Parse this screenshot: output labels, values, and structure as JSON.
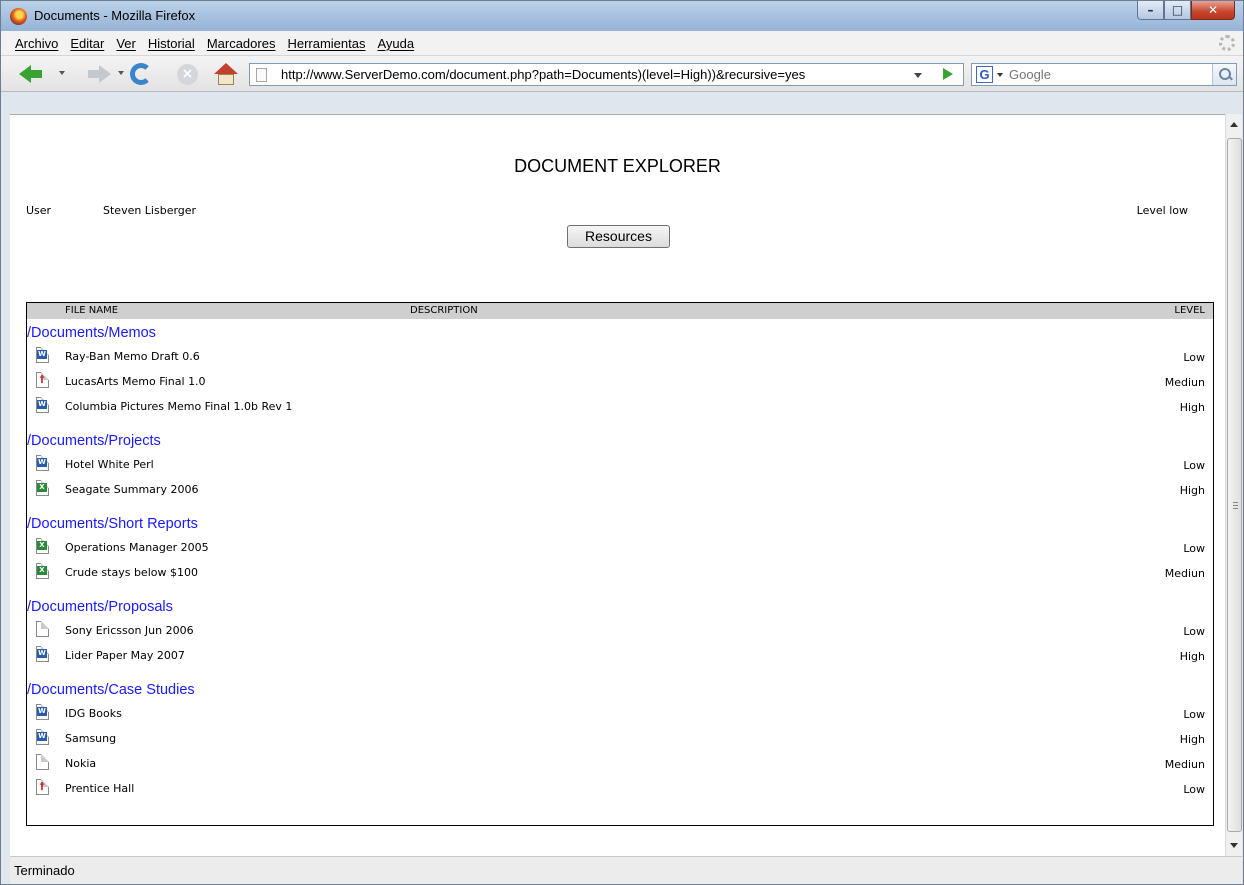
{
  "window": {
    "title": "Documents - Mozilla Firefox"
  },
  "menu": [
    "Archivo",
    "Editar",
    "Ver",
    "Historial",
    "Marcadores",
    "Herramientas",
    "Ayuda"
  ],
  "toolbar": {
    "url": "http://www.ServerDemo.com/document.php?path=Documents)(level=High))&recursive=yes",
    "search_placeholder": "Google",
    "search_engine_letter": "G"
  },
  "status": {
    "text": "Terminado"
  },
  "page": {
    "title": "DOCUMENT EXPLORER",
    "user_label": "User",
    "user_name": "Steven Lisberger",
    "level": "Level low",
    "resources_button": "Resources"
  },
  "table": {
    "headers": {
      "file_name": "FILE NAME",
      "description": "DESCRIPTION",
      "level": "LEVEL"
    },
    "groups": [
      {
        "path": "/Documents/Memos",
        "files": [
          {
            "name": "Ray-Ban Memo Draft 0.6",
            "level": "Low",
            "icon": "word-doc-icon"
          },
          {
            "name": "LucasArts Memo Final 1.0",
            "level": "Mediun",
            "icon": "pdf-doc-icon"
          },
          {
            "name": "Columbia Pictures Memo Final 1.0b Rev 1",
            "level": "High",
            "icon": "word-doc-icon"
          }
        ]
      },
      {
        "path": "/Documents/Projects",
        "files": [
          {
            "name": "Hotel White Perl",
            "level": "Low",
            "icon": "word-doc-icon"
          },
          {
            "name": "Seagate Summary 2006",
            "level": "High",
            "icon": "excel-doc-icon"
          }
        ]
      },
      {
        "path": "/Documents/Short Reports",
        "files": [
          {
            "name": "Operations Manager 2005",
            "level": "Low",
            "icon": "excel-doc-icon"
          },
          {
            "name": "Crude stays below $100",
            "level": "Mediun",
            "icon": "excel-doc-icon"
          }
        ]
      },
      {
        "path": "/Documents/Proposals",
        "files": [
          {
            "name": "Sony Ericsson Jun 2006",
            "level": "Low",
            "icon": "blank-doc-icon"
          },
          {
            "name": "Lider Paper May 2007",
            "level": "High",
            "icon": "word-doc-icon"
          }
        ]
      },
      {
        "path": "/Documents/Case Studies",
        "files": [
          {
            "name": "IDG Books",
            "level": "Low",
            "icon": "word-doc-icon"
          },
          {
            "name": "Samsung",
            "level": "High",
            "icon": "word-doc-icon"
          },
          {
            "name": "Nokia",
            "level": "Mediun",
            "icon": "blank-doc-icon"
          },
          {
            "name": "Prentice Hall",
            "level": "Low",
            "icon": "pdf-doc-icon"
          }
        ]
      }
    ]
  }
}
